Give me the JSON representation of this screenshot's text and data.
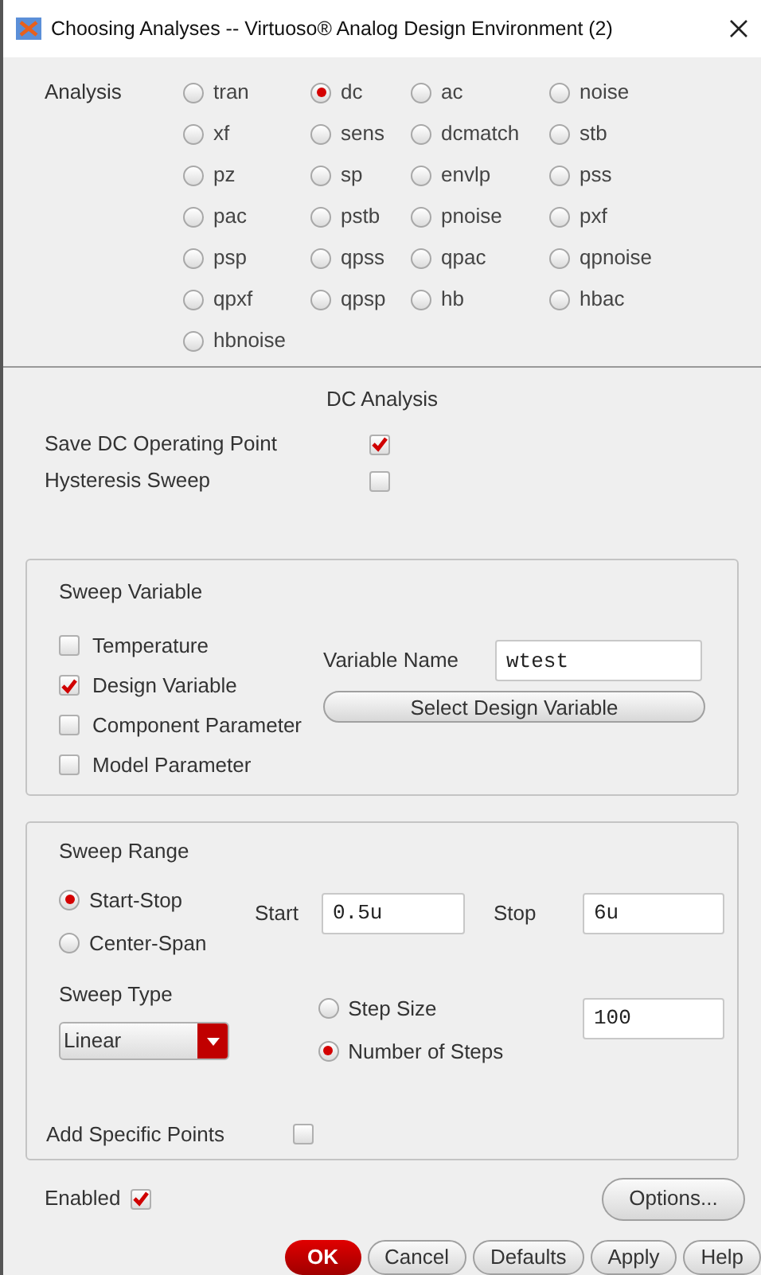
{
  "window": {
    "title": "Choosing Analyses -- Virtuoso® Analog Design Environment (2)"
  },
  "analysis": {
    "label": "Analysis",
    "options": [
      {
        "label": "tran",
        "selected": false
      },
      {
        "label": "dc",
        "selected": true
      },
      {
        "label": "ac",
        "selected": false
      },
      {
        "label": "noise",
        "selected": false
      },
      {
        "label": "xf",
        "selected": false
      },
      {
        "label": "sens",
        "selected": false
      },
      {
        "label": "dcmatch",
        "selected": false
      },
      {
        "label": "stb",
        "selected": false
      },
      {
        "label": "pz",
        "selected": false
      },
      {
        "label": "sp",
        "selected": false
      },
      {
        "label": "envlp",
        "selected": false
      },
      {
        "label": "pss",
        "selected": false
      },
      {
        "label": "pac",
        "selected": false
      },
      {
        "label": "pstb",
        "selected": false
      },
      {
        "label": "pnoise",
        "selected": false
      },
      {
        "label": "pxf",
        "selected": false
      },
      {
        "label": "psp",
        "selected": false
      },
      {
        "label": "qpss",
        "selected": false
      },
      {
        "label": "qpac",
        "selected": false
      },
      {
        "label": "qpnoise",
        "selected": false
      },
      {
        "label": "qpxf",
        "selected": false
      },
      {
        "label": "qpsp",
        "selected": false
      },
      {
        "label": "hb",
        "selected": false
      },
      {
        "label": "hbac",
        "selected": false
      },
      {
        "label": "hbnoise",
        "selected": false
      }
    ]
  },
  "dc_analysis": {
    "heading": "DC Analysis",
    "options": [
      {
        "label": "Save DC Operating Point",
        "checked": true
      },
      {
        "label": "Hysteresis Sweep",
        "checked": false
      }
    ]
  },
  "sweep_variable": {
    "heading": "Sweep Variable",
    "options": [
      {
        "label": "Temperature",
        "checked": false
      },
      {
        "label": "Design Variable",
        "checked": true
      },
      {
        "label": "Component Parameter",
        "checked": false
      },
      {
        "label": "Model Parameter",
        "checked": false
      }
    ],
    "variable_name": {
      "label": "Variable Name",
      "value": "wtest"
    },
    "select_button": "Select Design Variable"
  },
  "sweep_range": {
    "heading": "Sweep Range",
    "modes": [
      {
        "label": "Start-Stop",
        "selected": true
      },
      {
        "label": "Center-Span",
        "selected": false
      }
    ],
    "start": {
      "label": "Start",
      "value": "0.5u"
    },
    "stop": {
      "label": "Stop",
      "value": "6u"
    },
    "sweep_type": {
      "label": "Sweep Type",
      "value": "Linear"
    },
    "step_modes": [
      {
        "label": "Step Size",
        "selected": false
      },
      {
        "label": "Number of Steps",
        "selected": true
      }
    ],
    "steps_value": "100",
    "add_specific_points": {
      "label": "Add Specific Points",
      "checked": false
    }
  },
  "enabled": {
    "label": "Enabled",
    "checked": true
  },
  "options_button": "Options...",
  "buttons": [
    {
      "label": "OK",
      "kind": "primary"
    },
    {
      "label": "Cancel",
      "kind": "normal"
    },
    {
      "label": "Defaults",
      "kind": "normal"
    },
    {
      "label": "Apply",
      "kind": "normal"
    },
    {
      "label": "Help",
      "kind": "normal"
    }
  ]
}
